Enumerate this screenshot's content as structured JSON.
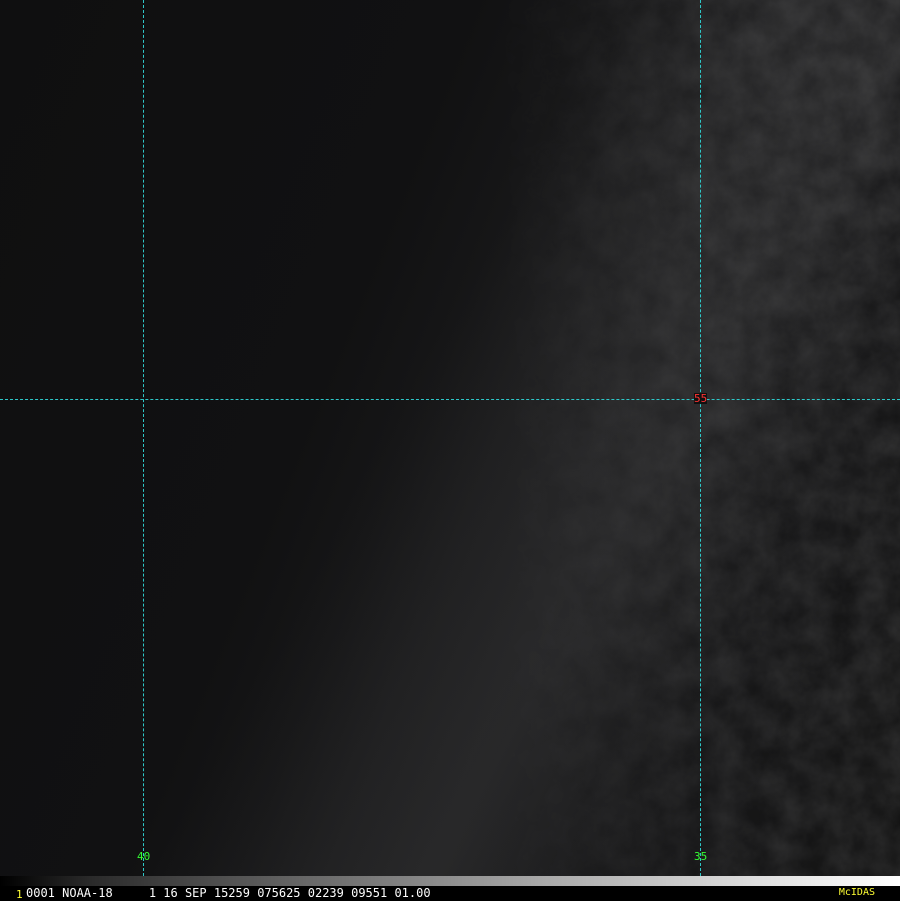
{
  "grid": {
    "longitude_labels": [
      "40",
      "35"
    ],
    "latitude_labels": [
      "55"
    ],
    "colors": {
      "line": "#2ec8c8",
      "longitude_label": "#33ff33",
      "latitude_label": "#ff3333"
    }
  },
  "footer": {
    "frame_number": "1",
    "info_text": "0001 NOAA-18     1 16 SEP 15259 075625 02239 09551 01.00",
    "logo": "McIDAS",
    "colors": {
      "frame_number": "#ffff33",
      "info_text": "#ffffff",
      "logo": "#ffff33"
    }
  }
}
